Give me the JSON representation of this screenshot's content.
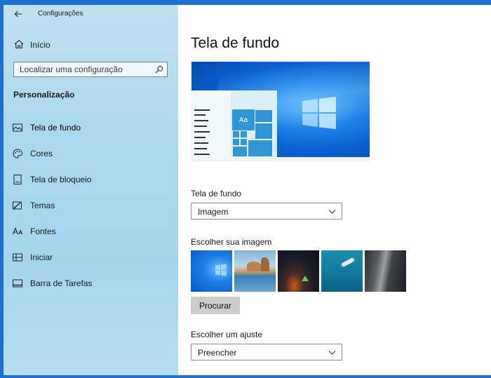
{
  "app": {
    "title": "Configurações"
  },
  "sidebar": {
    "home_label": "Início",
    "search_placeholder": "Localizar uma configuração",
    "section_title": "Personalização",
    "items": [
      {
        "label": "Tela de fundo",
        "icon": "picture-icon",
        "active": true
      },
      {
        "label": "Cores",
        "icon": "palette-icon",
        "active": false
      },
      {
        "label": "Tela de bloqueio",
        "icon": "lock-screen-icon",
        "active": false
      },
      {
        "label": "Temas",
        "icon": "themes-icon",
        "active": false
      },
      {
        "label": "Fontes",
        "icon": "fonts-icon",
        "active": false
      },
      {
        "label": "Iniciar",
        "icon": "start-icon",
        "active": false
      },
      {
        "label": "Barra de Tarefas",
        "icon": "taskbar-icon",
        "active": false
      }
    ]
  },
  "main": {
    "page_title": "Tela de fundo",
    "preview_tile_text": "Aa",
    "background_label": "Tela de fundo",
    "background_value": "Imagem",
    "choose_image_label": "Escolher sua imagem",
    "browse_button": "Procurar",
    "fit_label": "Escolher um ajuste",
    "fit_value": "Preencher"
  },
  "colors": {
    "sidebar_bg": "#abd8ee",
    "accent": "#0a62d0",
    "button_bg": "#cccccc"
  }
}
